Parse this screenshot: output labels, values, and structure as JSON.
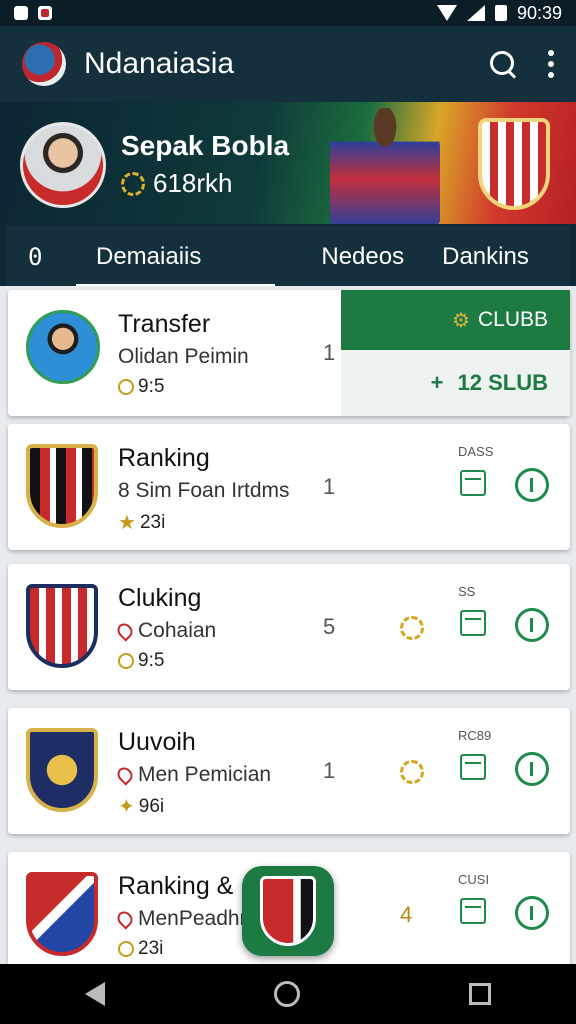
{
  "status_bar": {
    "time": "90:39"
  },
  "app_bar": {
    "title": "Ndanaiasia"
  },
  "hero": {
    "title": "Sepak Bobla",
    "subtitle": "618rkh"
  },
  "tabs": {
    "icon_glyph": "0",
    "items": [
      "Demaiaiis",
      "Nedeos",
      "Dankins"
    ],
    "active": 0
  },
  "cards": [
    {
      "title": "Transfer",
      "subtitle": "Olidan Peimin",
      "meta": "9:5",
      "count": "1",
      "tag": "",
      "club_top": "CLUBB",
      "club_bottom_plus": "+",
      "club_bottom": "12 SLUB"
    },
    {
      "title": "Ranking",
      "subtitle": "8 Sim Foan Irtdms",
      "meta": "23i",
      "count": "1",
      "tag": "DASS"
    },
    {
      "title": "Cluking",
      "subtitle": "Cohaian",
      "meta": "9:5",
      "count": "5",
      "tag": "SS"
    },
    {
      "title": "Uuvoih",
      "subtitle": "Men Pemician",
      "meta": "96i",
      "count": "1",
      "tag": "RC89"
    },
    {
      "title": "Ranking &",
      "subtitle": "MenPeadhr",
      "meta": "23i",
      "count": "4",
      "tag": "CUSI"
    }
  ],
  "colors": {
    "primary": "#13303c",
    "accent_green": "#1d7a43",
    "gold": "#d6a41f",
    "red": "#c62a2a"
  }
}
